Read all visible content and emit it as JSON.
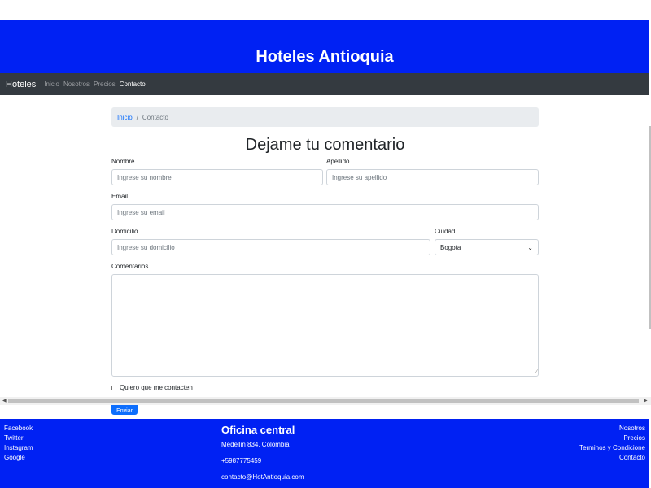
{
  "header": {
    "title": "Hoteles Antioquia"
  },
  "nav": {
    "brand": "Hoteles",
    "links": [
      {
        "label": "Inicio"
      },
      {
        "label": "Nosotros"
      },
      {
        "label": "Precios"
      },
      {
        "label": "Contacto"
      }
    ]
  },
  "breadcrumb": {
    "home": "Inicio",
    "separator": "/",
    "current": "Contacto"
  },
  "form": {
    "title": "Dejame tu comentario",
    "nombre": {
      "label": "Nombre",
      "placeholder": "Ingrese su nombre"
    },
    "apellido": {
      "label": "Apellido",
      "placeholder": "Ingrese su apellido"
    },
    "email": {
      "label": "Email",
      "placeholder": "Ingrese su email"
    },
    "domicilio": {
      "label": "Domicilio",
      "placeholder": "Ingrese su domicilio"
    },
    "ciudad": {
      "label": "Ciudad",
      "selected": "Bogota"
    },
    "comentarios": {
      "label": "Comentarios",
      "value": ""
    },
    "contact_checkbox": {
      "label": "Quiero que me contacten",
      "checked": false
    },
    "submit_label": "Enviar"
  },
  "footer": {
    "social": [
      "Facebook",
      "Twitter",
      "Instagram",
      "Google"
    ],
    "office": {
      "title": "Oficina central",
      "address": "Medellin 834, Colombia",
      "phone": "+5987775459",
      "email": "contacto@HotAntioquia.com"
    },
    "links": [
      "Nosotros",
      "Precios",
      "Terminos y Condicione",
      "Contacto"
    ]
  },
  "colors": {
    "brand_blue": "#0021f3",
    "navbar": "#343a40",
    "primary_button": "#0d6efd"
  },
  "icons": {
    "select": "chevron-down-icon",
    "scroll_left": "scroll-left-arrow-icon",
    "scroll_right": "scroll-right-arrow-icon"
  }
}
